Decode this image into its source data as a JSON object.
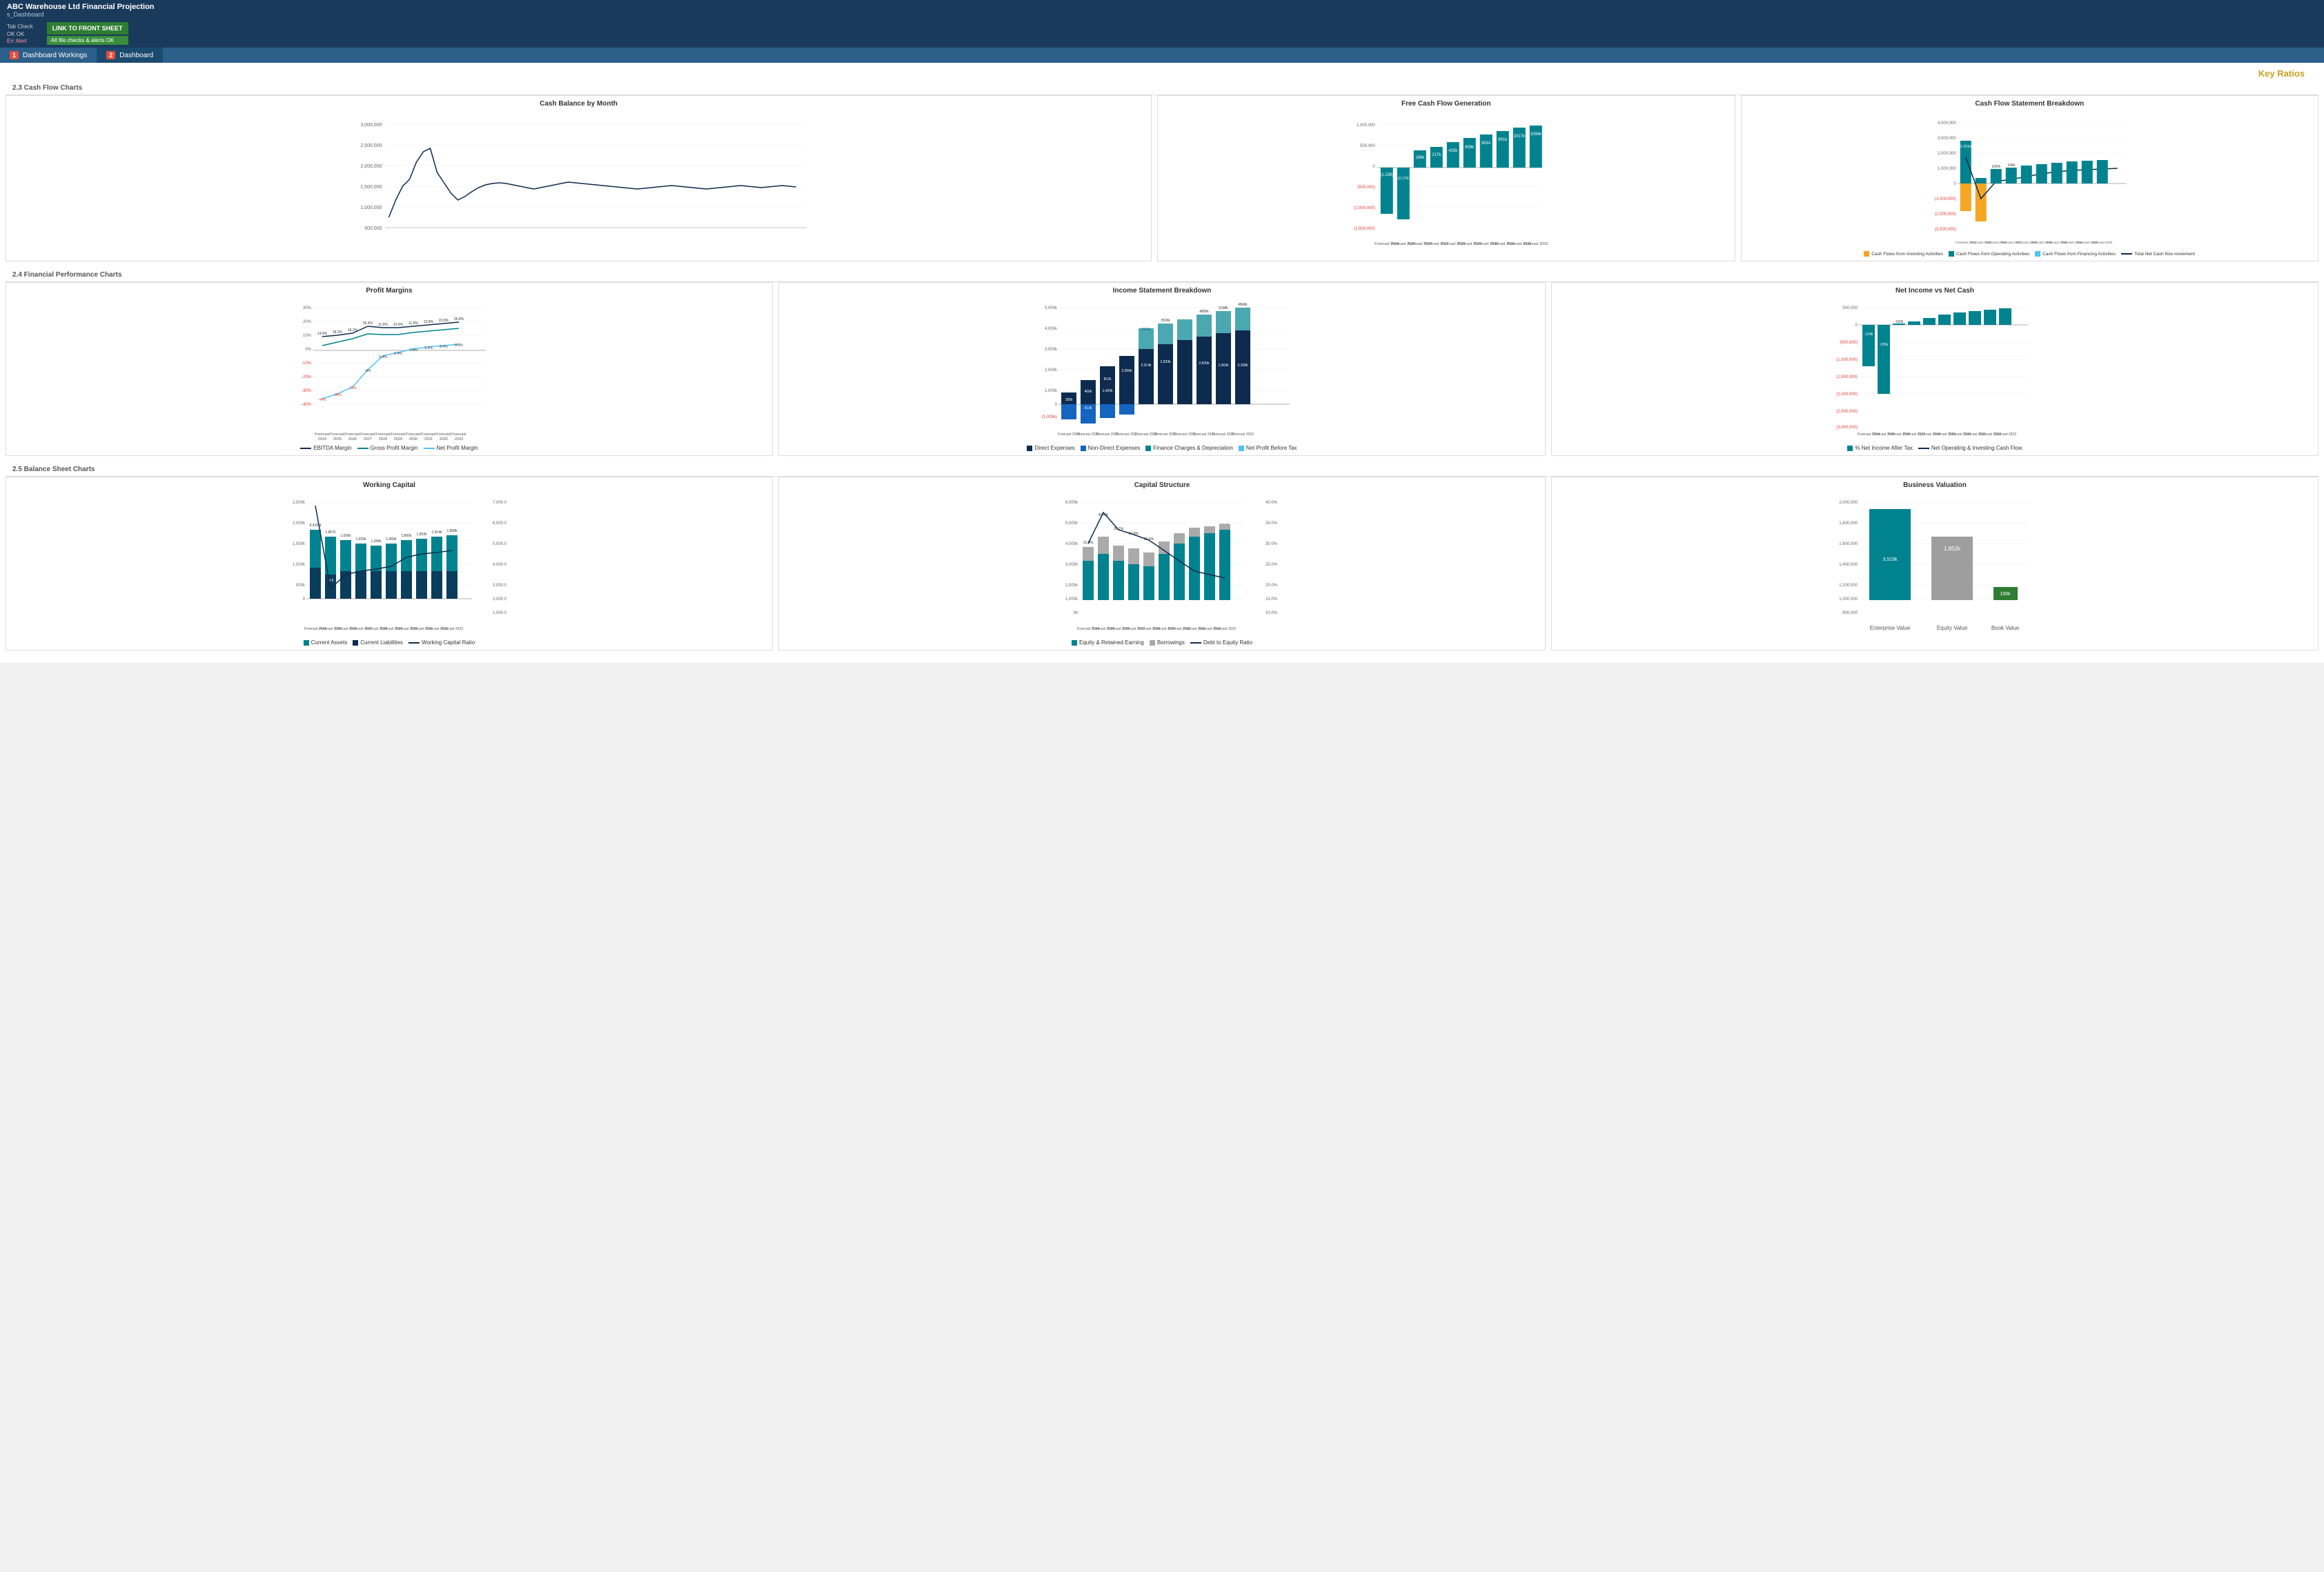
{
  "header": {
    "title": "ABC Warehouse Ltd Financial Projection",
    "subtitle": "s_Dashboard",
    "link_button": "LINK TO FRONT SHEET",
    "alert_text": "All file checks & alerts OK"
  },
  "tab_check": {
    "label": "Tab Check",
    "ok_label": "OK  OK",
    "err_label": "Err  Alert"
  },
  "nav": {
    "items": [
      {
        "num": "1",
        "label": "Dashboard Workings"
      },
      {
        "num": "2",
        "label": "Dashboard"
      }
    ]
  },
  "sections": {
    "cash_flow": "2.3   Cash Flow Charts",
    "financial": "2.4   Financial Performance Charts",
    "balance": "2.5   Balance Sheet Charts"
  },
  "key_ratios_title": "Key Ratios",
  "charts": {
    "cash_balance_title": "Cash Balance by Month",
    "free_cash_title": "Free Cash Flow Generation",
    "cash_flow_breakdown_title": "Cash Flow Statement Breakdown",
    "profit_margins_title": "Profit Margins",
    "income_statement_title": "Income Statement Breakdown",
    "net_income_title": "Net Income vs Net Cash",
    "working_capital_title": "Working Capital",
    "capital_structure_title": "Capital Structure",
    "business_valuation_title": "Business Valuation"
  },
  "legend": {
    "cash_flows_investing": "Cash Flows from Investing Activities",
    "cash_flows_operating": "Cash Flows from Operating Activities",
    "cash_flows_financing": "Cash Flows from Financing Activities",
    "total_net_cash": "Total Net Cash flow movement",
    "ebitda_margin": "EBITDA Margin",
    "gross_profit_margin": "Gross Profit Margin",
    "net_profit_margin": "Net Profit Margin",
    "direct_expenses": "Direct Expenses",
    "non_direct_expenses": "Non-Direct Expenses",
    "finance_charges": "Finance Charges & Depreciation",
    "net_profit_before_tax": "Net Profit Before Tax",
    "net_income_after_tax": "% Net Income After Tax",
    "net_operating_investing": "Net Operating & Investing Cash Flow",
    "current_assets": "Current Assets",
    "current_liabilities": "Current Liabilities",
    "working_capital_ratio": "Working Capital Ratio",
    "equity_retained": "Equity & Retained Earning",
    "borrowings": "Borrowings",
    "debt_to_equity": "Debt to Equity Ratio"
  },
  "forecast_years": [
    "Forecast\n2024",
    "Forecast\n2025",
    "Forecast\n2026",
    "Forecast\n2027",
    "Forecast\n2028",
    "Forecast\n2029",
    "Forecast\n2030",
    "Forecast\n2031",
    "Forecast\n2032",
    "Forecast\n2033"
  ],
  "colors": {
    "dark_navy": "#0d2b4e",
    "teal": "#1a8a8a",
    "light_teal": "#00bcd4",
    "orange": "#f5a623",
    "red": "#e53935",
    "green": "#2e7d32",
    "mid_blue": "#1565c0",
    "light_blue": "#4fc3f7",
    "chart_line": "#0d2b4e",
    "bar_teal": "#00838f",
    "bar_navy": "#0d2b4e",
    "bar_orange": "#f5a623",
    "header_blue": "#1a3a5c",
    "nav_blue": "#2c5f8a"
  }
}
